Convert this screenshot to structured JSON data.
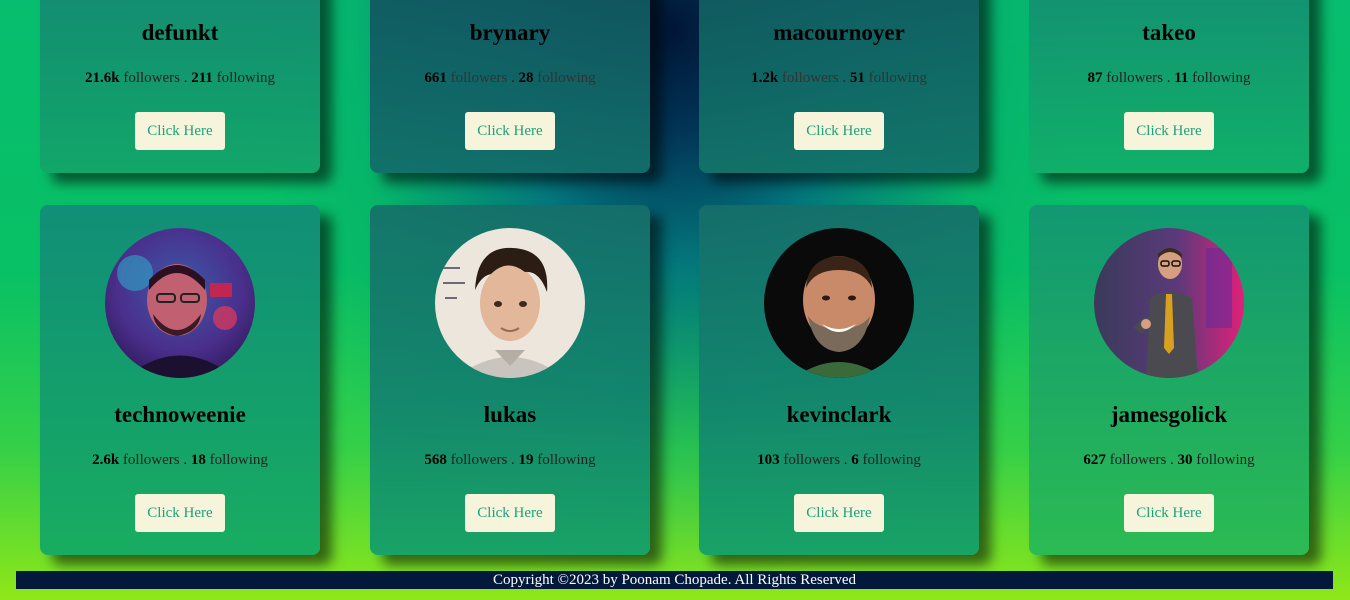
{
  "cards": [
    {
      "username": "defunkt",
      "followers": "21.6k",
      "following": "211",
      "button": "Click Here"
    },
    {
      "username": "brynary",
      "followers": "661",
      "following": "28",
      "button": "Click Here"
    },
    {
      "username": "macournoyer",
      "followers": "1.2k",
      "following": "51",
      "button": "Click Here"
    },
    {
      "username": "takeo",
      "followers": "87",
      "following": "11",
      "button": "Click Here"
    },
    {
      "username": "technoweenie",
      "followers": "2.6k",
      "following": "18",
      "button": "Click Here"
    },
    {
      "username": "lukas",
      "followers": "568",
      "following": "19",
      "button": "Click Here"
    },
    {
      "username": "kevinclark",
      "followers": "103",
      "following": "6",
      "button": "Click Here"
    },
    {
      "username": "jamesgolick",
      "followers": "627",
      "following": "30",
      "button": "Click Here"
    }
  ],
  "labels": {
    "followers": "followers",
    "separator": ".",
    "following": "following"
  },
  "footer": {
    "text": "Copyright ©2023 by Poonam Chopade. All Rights Reserved"
  },
  "colors": {
    "button_bg": "#f7f4dc",
    "button_text": "#1aa37a",
    "footer_bg": "#03193b"
  }
}
